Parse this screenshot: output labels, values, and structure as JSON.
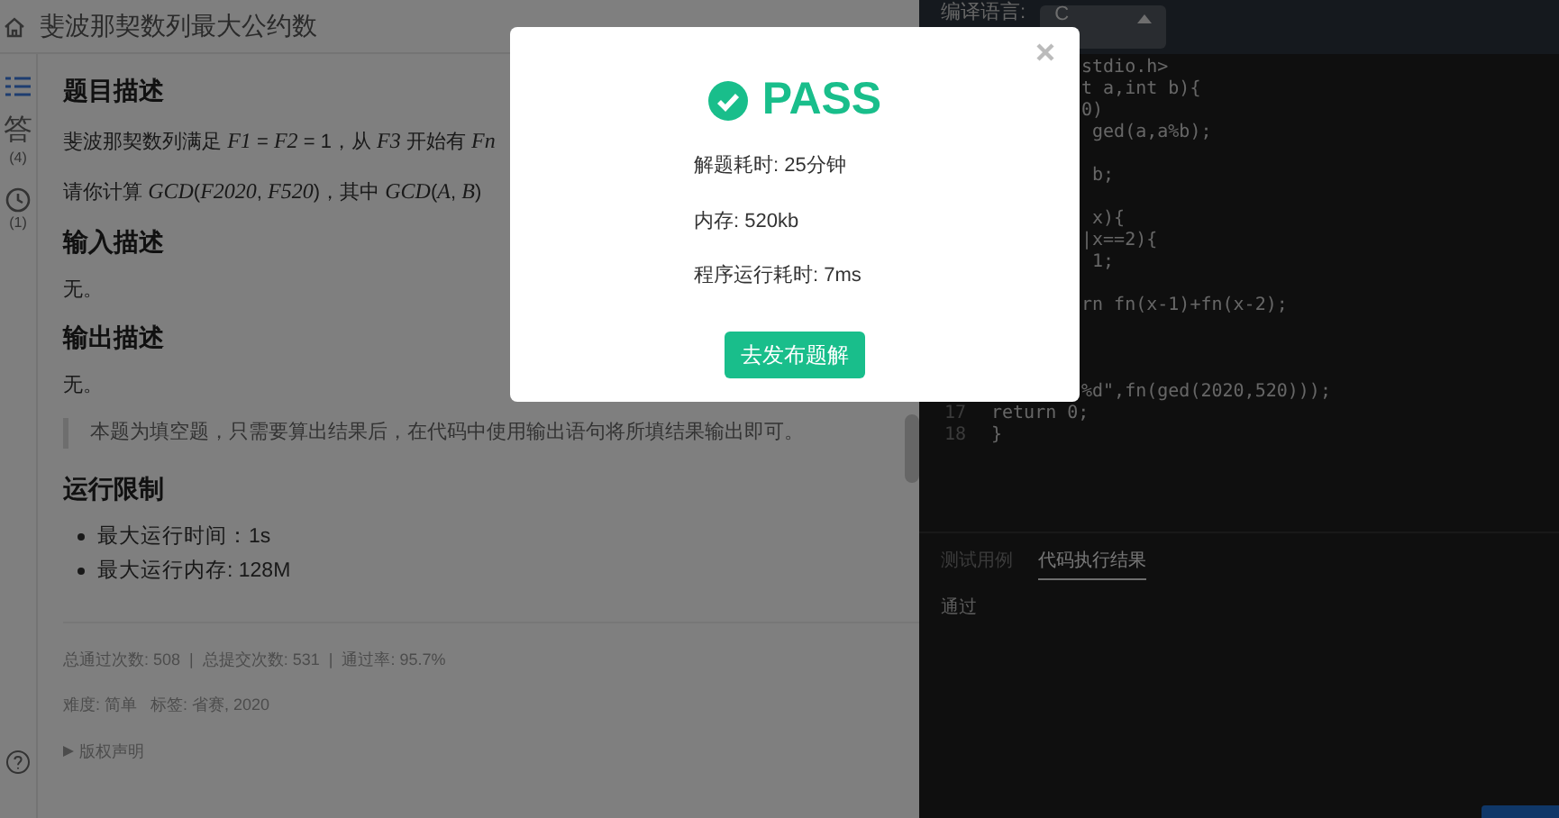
{
  "header": {
    "title": "斐波那契数列最大公约数"
  },
  "sidebar": {
    "items": [
      {
        "kind": "list",
        "selected": true
      },
      {
        "kind": "answer",
        "label": "答",
        "count": "(4)",
        "selected": false
      },
      {
        "kind": "history",
        "count": "(1)",
        "selected": false
      },
      {
        "kind": "help",
        "selected": false
      }
    ]
  },
  "problem": {
    "sections": [
      {
        "heading": "题目描述",
        "paragraphs": [
          "斐波那契数列满足 *F1* = *F2* = 1，从 *F3* 开始有 *Fn*",
          "请你计算 *GCD*(*F2020*, *F520*)，其中 *GCD*(*A*, *B*)"
        ]
      },
      {
        "heading": "输入描述",
        "paragraphs": [
          "无。"
        ]
      },
      {
        "heading": "输出描述",
        "paragraphs": [
          "无。"
        ],
        "note": "本题为填空题，只需要算出结果后，在代码中使用输出语句将所填结果输出即可。"
      },
      {
        "heading": "运行限制",
        "bullets": [
          "最大运行时间：1s",
          "最大运行内存: 128M"
        ]
      }
    ],
    "stats": "总通过次数: 508  |  总提交次数: 531  |  通过率: 95.7%",
    "meta": "难度: 简单   标签: 省赛, 2020",
    "copyright": {
      "label": "版权声明",
      "expanded": false
    }
  },
  "editor": {
    "language_label": "编译语言:",
    "language": "C",
    "lines": [
      {
        "kind": "code",
        "text": "stdio.h>"
      },
      {
        "kind": "code",
        "text": "t a,int b){"
      },
      {
        "kind": "code",
        "text": "0)"
      },
      {
        "kind": "code",
        "text": " ged(a,a%b);"
      },
      {
        "kind": "blank"
      },
      {
        "kind": "code",
        "text": " b;"
      },
      {
        "kind": "blank"
      },
      {
        "kind": "code",
        "text": " x){"
      },
      {
        "kind": "code",
        "text": "|x==2){"
      },
      {
        "kind": "code",
        "text": " 1;"
      },
      {
        "kind": "blank"
      },
      {
        "kind": "code",
        "text": "rn fn(x-1)+fn(x-2);"
      },
      {
        "kind": "blank"
      },
      {
        "kind": "blank"
      },
      {
        "kind": "blank"
      },
      {
        "kind": "code",
        "text": "%d\",fn(ged(2020,520)));"
      },
      {
        "kind": "code",
        "number": "17",
        "text": "return 0;"
      },
      {
        "kind": "code",
        "number": "18",
        "text": "}"
      }
    ]
  },
  "output": {
    "tabs": [
      {
        "label": "测试用例",
        "selected": false
      },
      {
        "label": "代码执行结果",
        "selected": true
      }
    ],
    "result": "通过"
  },
  "modal": {
    "status": "PASS",
    "details": [
      "解题耗时: 25分钟",
      "内存: 520kb",
      "程序运行耗时: 7ms"
    ],
    "button": "去发布题解"
  }
}
